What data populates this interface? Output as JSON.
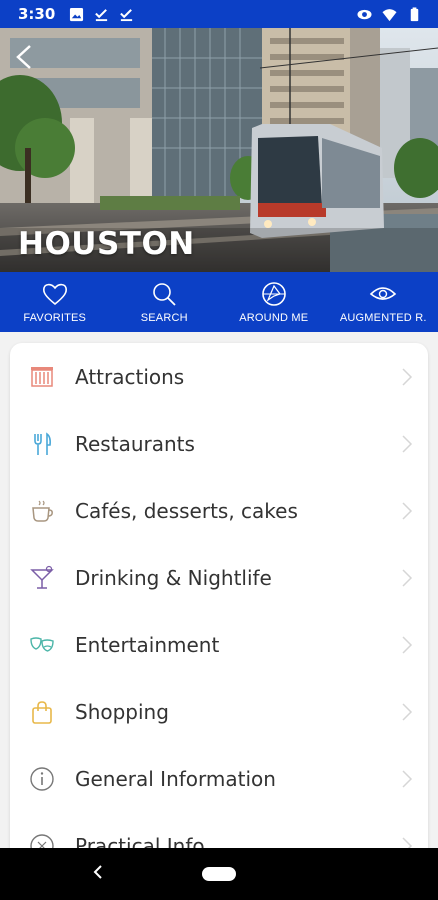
{
  "status": {
    "time": "3:30",
    "left_icons": [
      "image-icon",
      "check-icon",
      "check-icon"
    ],
    "right_icons": [
      "eye-icon",
      "wifi-icon",
      "battery-icon"
    ]
  },
  "hero": {
    "title": "HOUSTON",
    "back_icon": "back-arrow-icon"
  },
  "tabs": [
    {
      "label": "FAVORITES",
      "icon": "heart-icon"
    },
    {
      "label": "SEARCH",
      "icon": "search-icon"
    },
    {
      "label": "AROUND ME",
      "icon": "around-me-icon"
    },
    {
      "label": "AUGMENTED R.",
      "icon": "eye-icon"
    }
  ],
  "menu": [
    {
      "label": "Attractions",
      "icon": "attractions-icon",
      "color": "#e8887a"
    },
    {
      "label": "Restaurants",
      "icon": "fork-knife-icon",
      "color": "#4aa8d8"
    },
    {
      "label": "Cafés, desserts, cakes",
      "icon": "coffee-cup-icon",
      "color": "#a89680"
    },
    {
      "label": "Drinking & Nightlife",
      "icon": "cocktail-icon",
      "color": "#7b5ea7"
    },
    {
      "label": "Entertainment",
      "icon": "masks-icon",
      "color": "#4bb5a8"
    },
    {
      "label": "Shopping",
      "icon": "shopping-bag-icon",
      "color": "#e8b84a"
    },
    {
      "label": "General Information",
      "icon": "info-icon",
      "color": "#777777"
    },
    {
      "label": "Practical Info",
      "icon": "practical-info-icon",
      "color": "#777777"
    }
  ],
  "colors": {
    "brand_blue": "#0c40c6",
    "card_bg": "#ffffff",
    "text": "#333333"
  }
}
